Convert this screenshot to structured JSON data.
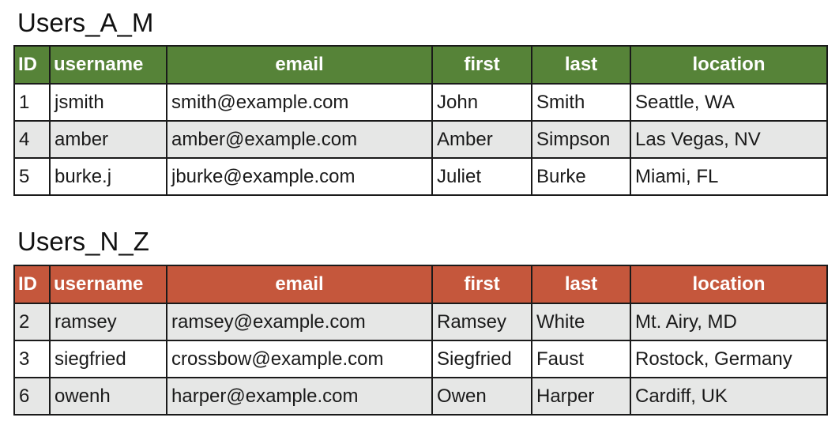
{
  "tables": [
    {
      "title": "Users_A_M",
      "header_color": "#568338",
      "columns": [
        "ID",
        "username",
        "email",
        "first",
        "last",
        "location"
      ],
      "rows": [
        [
          "1",
          "jsmith",
          "smith@example.com",
          "John",
          "Smith",
          "Seattle, WA"
        ],
        [
          "4",
          "amber",
          "amber@example.com",
          "Amber",
          "Simpson",
          "Las Vegas, NV"
        ],
        [
          "5",
          "burke.j",
          "jburke@example.com",
          "Juliet",
          "Burke",
          "Miami, FL"
        ]
      ]
    },
    {
      "title": "Users_N_Z",
      "header_color": "#c5573c",
      "columns": [
        "ID",
        "username",
        "email",
        "first",
        "last",
        "location"
      ],
      "rows": [
        [
          "2",
          "ramsey",
          "ramsey@example.com",
          "Ramsey",
          "White",
          "Mt. Airy, MD"
        ],
        [
          "3",
          "siegfried",
          "crossbow@example.com",
          "Siegfried",
          "Faust",
          "Rostock, Germany"
        ],
        [
          "6",
          "owenh",
          "harper@example.com",
          "Owen",
          "Harper",
          "Cardiff, UK"
        ]
      ]
    }
  ]
}
